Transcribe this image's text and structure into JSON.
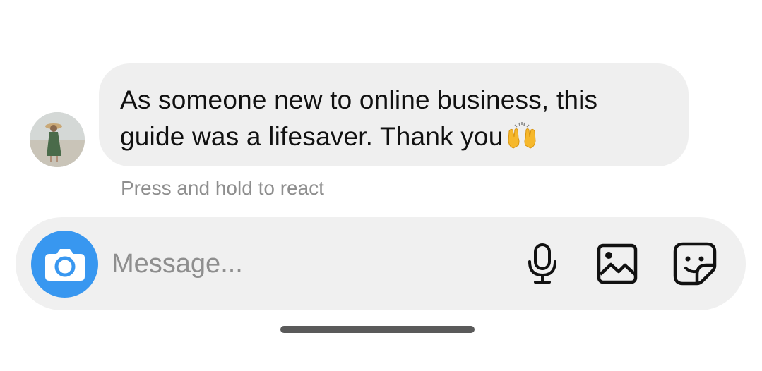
{
  "message": {
    "text": "As someone new to online business, this guide was a lifesaver. Thank you",
    "emoji": "raising-hands-emoji"
  },
  "hint": "Press and hold to react",
  "composer": {
    "placeholder": "Message...",
    "camera_icon": "camera-icon",
    "mic_icon": "microphone-icon",
    "gallery_icon": "gallery-icon",
    "sticker_icon": "sticker-icon"
  },
  "colors": {
    "bubble": "#efefef",
    "camera_button": "#3897f0",
    "hint_text": "#8e8e8e"
  }
}
